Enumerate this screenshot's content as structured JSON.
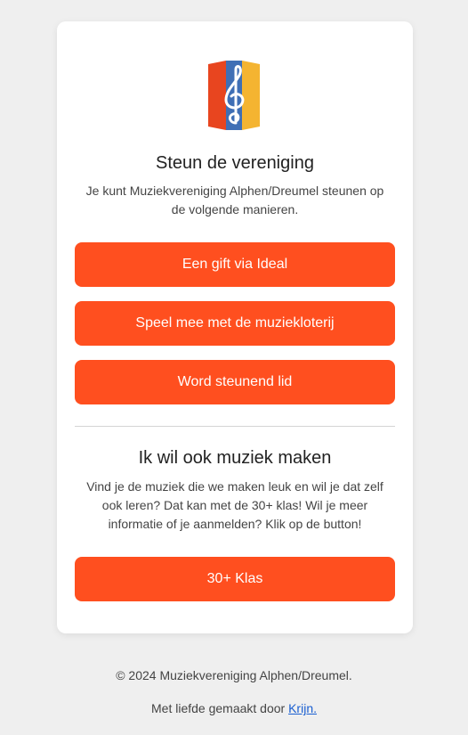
{
  "support": {
    "title": "Steun de vereniging",
    "description": "Je kunt Muziekvereniging Alphen/Dreumel steunen op de volgende manieren.",
    "buttons": [
      "Een gift via Ideal",
      "Speel mee met de muziekloterij",
      "Word steunend lid"
    ]
  },
  "music": {
    "title": "Ik wil ook muziek maken",
    "description": "Vind je de muziek die we maken leuk en wil je dat zelf ook leren? Dat kan met de 30+ klas! Wil je meer informatie of je aanmelden? Klik op de button!",
    "button": "30+ Klas"
  },
  "footer": {
    "copyright": "© 2024 Muziekvereniging Alphen/Dreumel.",
    "credit_prefix": "Met liefde gemaakt door ",
    "credit_link": "Krijn."
  },
  "colors": {
    "accent": "#ff4f1f",
    "background": "#efefef",
    "link": "#1a5fd1"
  },
  "icons": {
    "logo": "treble-clef-banner-logo"
  }
}
